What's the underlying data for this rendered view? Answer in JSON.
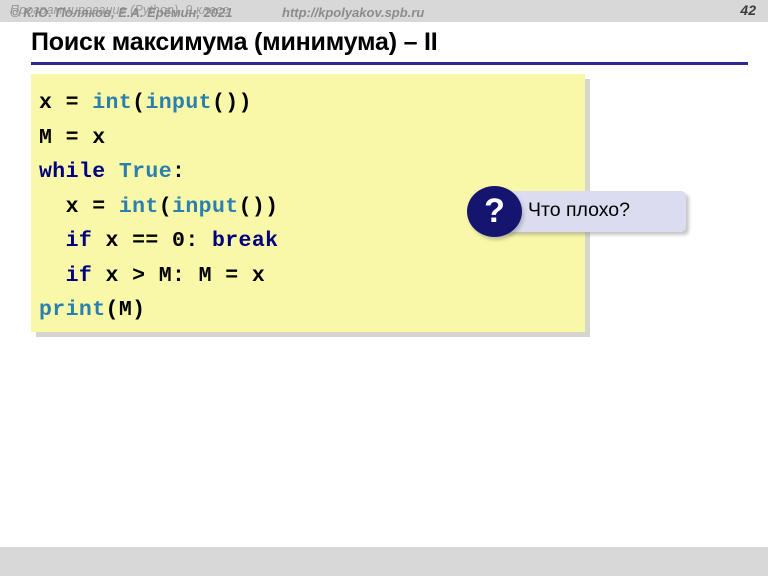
{
  "header": {
    "course_title": "Программирование (Python), 9 класс",
    "slide_number": "42"
  },
  "slide": {
    "title": "Поиск максимума (минимума) – II"
  },
  "code": {
    "language": "python",
    "lines": [
      [
        {
          "t": "x = ",
          "c": "plain"
        },
        {
          "t": "int",
          "c": "fn"
        },
        {
          "t": "(",
          "c": "plain"
        },
        {
          "t": "input",
          "c": "fn"
        },
        {
          "t": "())",
          "c": "plain"
        }
      ],
      [
        {
          "t": "M = x",
          "c": "plain"
        }
      ],
      [
        {
          "t": "while ",
          "c": "kw"
        },
        {
          "t": "True",
          "c": "fn"
        },
        {
          "t": ":",
          "c": "plain"
        }
      ],
      [
        {
          "t": "  x = ",
          "c": "plain"
        },
        {
          "t": "int",
          "c": "fn"
        },
        {
          "t": "(",
          "c": "plain"
        },
        {
          "t": "input",
          "c": "fn"
        },
        {
          "t": "())",
          "c": "plain"
        }
      ],
      [
        {
          "t": "  ",
          "c": "plain"
        },
        {
          "t": "if",
          "c": "kw"
        },
        {
          "t": " x == 0: ",
          "c": "plain"
        },
        {
          "t": "break",
          "c": "kw"
        }
      ],
      [
        {
          "t": "  ",
          "c": "plain"
        },
        {
          "t": "if",
          "c": "kw"
        },
        {
          "t": " x > M: M = x",
          "c": "plain"
        }
      ],
      [
        {
          "t": "print",
          "c": "fn"
        },
        {
          "t": "(M)",
          "c": "plain"
        }
      ]
    ]
  },
  "callout": {
    "badge_glyph": "?",
    "text": "Что плохо?"
  },
  "footer": {
    "copyright": "© К.Ю. Поляков, Е.А. Ерёмин, 2021",
    "url": "http://kpolyakov.spb.ru"
  },
  "colors": {
    "header_bar": "#d8d8d8",
    "title_rule": "#2b2b8f",
    "code_background": "#f8f8a8",
    "keyword": "#00007e",
    "function": "#2a7fae",
    "callout_background": "#dcdcf0",
    "callout_badge": "#151570"
  }
}
